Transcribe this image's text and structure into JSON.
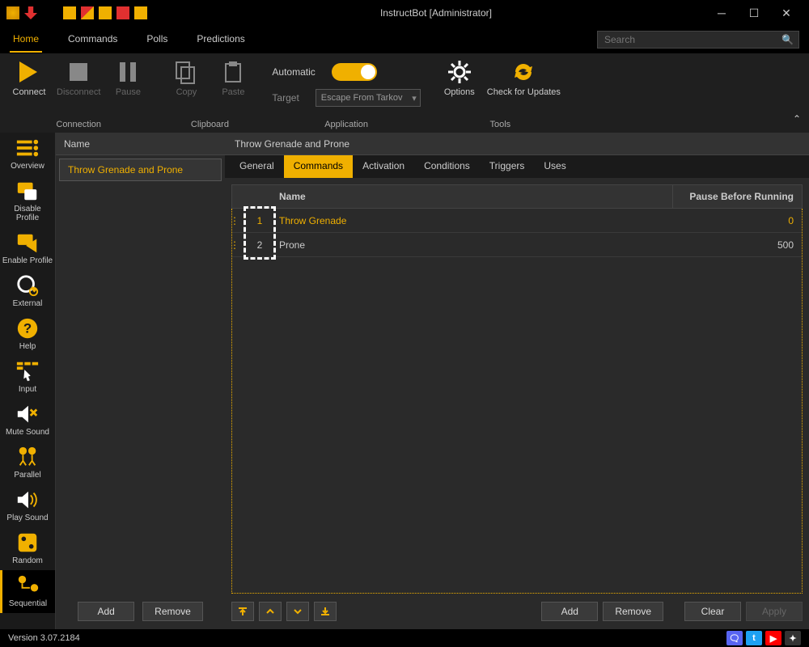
{
  "title": "InstructBot [Administrator]",
  "nav": {
    "tabs": [
      "Home",
      "Commands",
      "Polls",
      "Predictions"
    ],
    "active": 0,
    "search_placeholder": "Search"
  },
  "ribbon": {
    "groups": [
      {
        "title": "Connection",
        "items": [
          {
            "label": "Connect",
            "disabled": false
          },
          {
            "label": "Disconnect",
            "disabled": true
          },
          {
            "label": "Pause",
            "disabled": true
          }
        ]
      },
      {
        "title": "Clipboard",
        "items": [
          {
            "label": "Copy",
            "disabled": true
          },
          {
            "label": "Paste",
            "disabled": true
          }
        ]
      },
      {
        "title": "Application",
        "automatic_label": "Automatic",
        "target_label": "Target",
        "target_value": "Escape From Tarkov"
      },
      {
        "title": "Tools",
        "items": [
          {
            "label": "Options"
          },
          {
            "label": "Check for Updates"
          }
        ]
      }
    ]
  },
  "sidebar": [
    {
      "label": "Overview"
    },
    {
      "label": "Disable Profile"
    },
    {
      "label": "Enable Profile"
    },
    {
      "label": "External"
    },
    {
      "label": "Help"
    },
    {
      "label": "Input"
    },
    {
      "label": "Mute Sound"
    },
    {
      "label": "Parallel"
    },
    {
      "label": "Play Sound"
    },
    {
      "label": "Random"
    },
    {
      "label": "Sequential"
    }
  ],
  "sidebar_selected": 10,
  "listpane": {
    "header": "Name",
    "items": [
      "Throw Grenade and Prone"
    ],
    "add": "Add",
    "remove": "Remove"
  },
  "content": {
    "title": "Throw Grenade and Prone",
    "subtabs": [
      "General",
      "Commands",
      "Activation",
      "Conditions",
      "Triggers",
      "Uses"
    ],
    "subtab_active": 1,
    "columns": {
      "name": "Name",
      "pause": "Pause Before Running"
    },
    "rows": [
      {
        "num": "1",
        "name": "Throw Grenade",
        "pause": "0",
        "selected": true
      },
      {
        "num": "2",
        "name": "Prone",
        "pause": "500",
        "selected": false
      }
    ],
    "footer": {
      "add": "Add",
      "remove": "Remove",
      "clear": "Clear",
      "apply": "Apply"
    }
  },
  "status": {
    "version": "Version 3.07.2184"
  }
}
